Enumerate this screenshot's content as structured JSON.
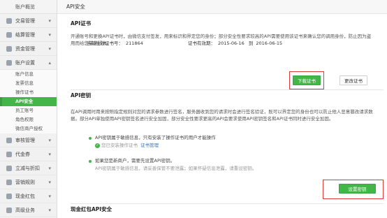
{
  "sidebar": {
    "top": "账户概览",
    "groups": [
      {
        "label": "交易管理"
      },
      {
        "label": "结算管理"
      },
      {
        "label": "资金管理"
      },
      {
        "label": "账户设置"
      },
      {
        "label": "审核管理"
      },
      {
        "label": "代金券"
      },
      {
        "label": "立减与折扣"
      },
      {
        "label": "营销规则"
      },
      {
        "label": "现金红包"
      },
      {
        "label": "高级业务"
      }
    ],
    "account_sub": [
      "账户信息",
      "发票信息",
      "操作证书",
      "API安全"
    ],
    "more_sub": [
      "员工账号",
      "角色权限",
      "微信商户授权"
    ]
  },
  "topbar": {
    "title": "API安全"
  },
  "cert": {
    "title": "API证书",
    "desc": "开通账号和更换API证书时，由微信支付签发，用来标识和界定您的身份；部分安全性要求较高的API需要使用该证书来确认您的调用身份，防止因为盗用而给您带来损失。",
    "number_label": "当前生效证书号：",
    "number": "211864",
    "valid_label": "证书有效期：",
    "valid_from": "2015-06-16",
    "valid_to_label": "到",
    "valid_to": "2016-06-15",
    "download_label": "下载证书",
    "change_label": "更改证书"
  },
  "apikey": {
    "title": "API密钥",
    "desc": "在API调用时用来按照指定规则对您的请求参数进行签名，服务器收到您的请求时会进行签名验证，既可以界定您的身份也可以防止他人恶意篡改请求数据。部分API单独使用API密钥签名进行安全加固，部分安全性要求更高的API会要求使用API密钥签名和API证书同时进行安全加固。",
    "line1": "API密钥属于敏感信息，只有安装了操作证书的用户才能操作",
    "line2_muted": "您已安装操作证书",
    "line2_link": "证书管理",
    "line3": "如果您是新商户，需要先设置API密钥。",
    "line4": "API密钥属于敏感信息，请妥善保管不要泄露；如果怀疑信息泄露，请重设密钥。",
    "set_label": "设置密钥"
  },
  "redpack": {
    "title": "现金红包API安全"
  },
  "colors": {
    "accent": "#44b549",
    "highlight": "#e03b3b",
    "link": "#3b77c5"
  }
}
